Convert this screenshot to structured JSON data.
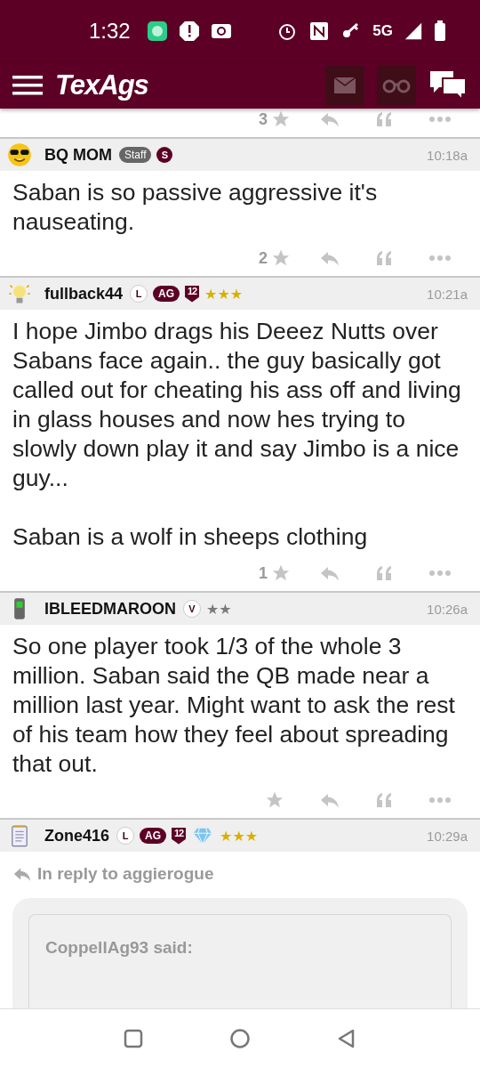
{
  "status_bar": {
    "time": "1:32",
    "network": "5G"
  },
  "header": {
    "logo": "TexAgs"
  },
  "clipped_actions": {
    "star_count": "3"
  },
  "posts": [
    {
      "username": "BQ MOM",
      "badges": [
        {
          "kind": "pill-gray",
          "text": "Staff"
        },
        {
          "kind": "circle-maroon",
          "text": "S"
        }
      ],
      "time": "10:18a",
      "paragraphs": [
        "Saban is so passive aggressive it's nauseating."
      ],
      "star_count": "2"
    },
    {
      "username": "fullback44",
      "badges": [
        {
          "kind": "circle-outline",
          "text": "L"
        },
        {
          "kind": "pill-maroon",
          "text": "AG"
        },
        {
          "kind": "shield",
          "text": "12"
        }
      ],
      "rank": "★★★",
      "gold_stars": true,
      "time": "10:21a",
      "paragraphs": [
        "I hope Jimbo drags his Deeez Nutts over Sabans face again.. the guy basically got called out for cheating his ass off and living in glass houses and now hes trying to slowly down play it and say Jimbo is a nice guy...",
        "Saban is a wolf in sheeps clothing"
      ],
      "star_count": "1"
    },
    {
      "username": "IBLEEDMAROON",
      "badges": [
        {
          "kind": "circle-outline",
          "text": "V"
        }
      ],
      "rank": "★★",
      "gold_stars": false,
      "time": "10:26a",
      "paragraphs": [
        "So one player took 1/3 of the whole 3 million. Saban said the QB made near a million last year. Might want to ask the rest of his team how they feel about spreading that out."
      ]
    },
    {
      "username": "Zone416",
      "badges": [
        {
          "kind": "circle-outline",
          "text": "L"
        },
        {
          "kind": "pill-maroon",
          "text": "AG"
        },
        {
          "kind": "shield",
          "text": "12"
        },
        {
          "kind": "diamond"
        }
      ],
      "rank": "★★★",
      "gold_stars": true,
      "time": "10:29a",
      "reply_to": "In reply to aggierogue",
      "quote_author": "CoppellAg93 said:"
    }
  ]
}
